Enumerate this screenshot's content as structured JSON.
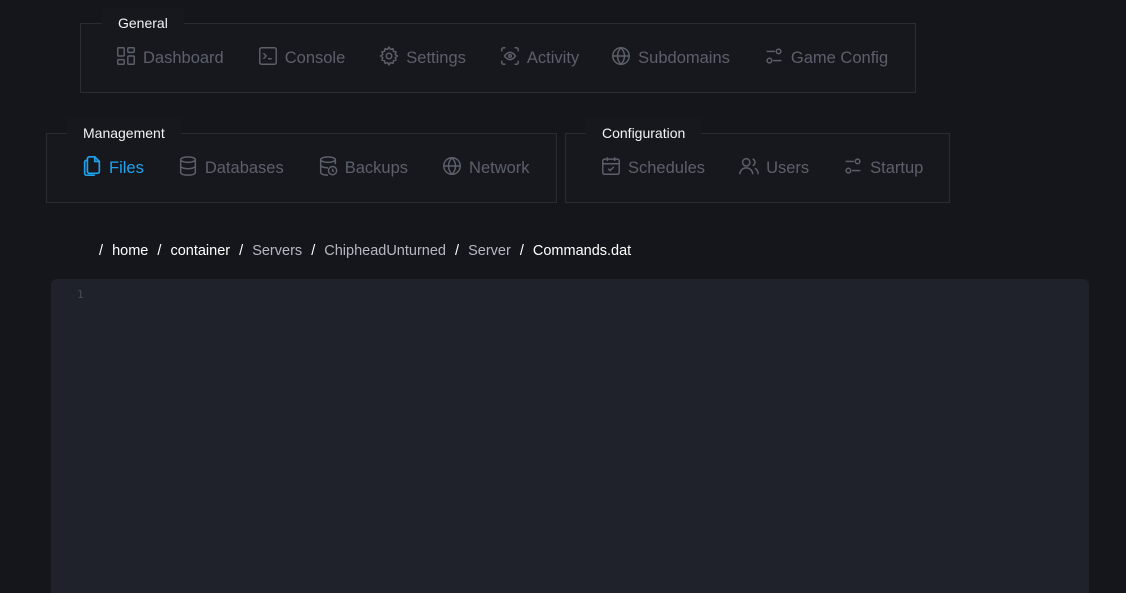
{
  "general": {
    "title": "General",
    "items": [
      {
        "label": "Dashboard",
        "icon": "dashboard-icon"
      },
      {
        "label": "Console",
        "icon": "terminal-icon"
      },
      {
        "label": "Settings",
        "icon": "gear-icon"
      },
      {
        "label": "Activity",
        "icon": "eye-scan-icon"
      },
      {
        "label": "Subdomains",
        "icon": "globe-icon"
      },
      {
        "label": "Game Config",
        "icon": "sliders-icon"
      }
    ]
  },
  "management": {
    "title": "Management",
    "items": [
      {
        "label": "Files",
        "icon": "files-icon",
        "active": true
      },
      {
        "label": "Databases",
        "icon": "database-icon"
      },
      {
        "label": "Backups",
        "icon": "database-backup-icon"
      },
      {
        "label": "Network",
        "icon": "globe-icon"
      }
    ]
  },
  "configuration": {
    "title": "Configuration",
    "items": [
      {
        "label": "Schedules",
        "icon": "calendar-check-icon"
      },
      {
        "label": "Users",
        "icon": "users-icon"
      },
      {
        "label": "Startup",
        "icon": "sliders-icon"
      }
    ]
  },
  "breadcrumb": {
    "separator": "/",
    "segments": [
      "home",
      "container",
      "Servers",
      "ChipheadUnturned",
      "Server",
      "Commands.dat"
    ]
  },
  "editor": {
    "line_numbers": [
      "1"
    ],
    "content": ""
  },
  "colors": {
    "active": "#1ea3f0",
    "inactive": "#5b606b",
    "background": "#15161b",
    "editor_background": "#1f222a"
  }
}
